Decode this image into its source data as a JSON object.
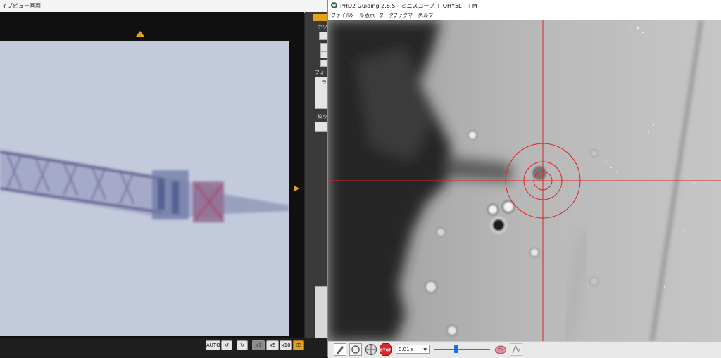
{
  "live_view": {
    "title": "イブビュー画面",
    "panel": {
      "white_balance_label": "ホワイ",
      "focus_label": "フォー",
      "focus_sub_label": "ラ",
      "aperture_label": "絞り込"
    },
    "toolbar": {
      "auto_label": "AUTO",
      "zoom_1x": "x1",
      "zoom_5x": "x5",
      "zoom_10x": "x10"
    }
  },
  "phd2": {
    "title": "PHD2 Guiding 2.6.5 - ミニスコープ + QHY5L - II M",
    "menu": [
      "ファイル",
      "ツール",
      "表示",
      "ダーク",
      "ブックマーク",
      "ヘルプ"
    ],
    "toolbar": {
      "stop_label": "STOP",
      "exposure": "0.01 s",
      "gamma_level": 0.4
    }
  },
  "colors": {
    "accent_orange": "#e0a21c",
    "crosshair_red": "#dd2222",
    "slider_blue": "#1c6fe0",
    "stop_red": "#d9262c"
  }
}
